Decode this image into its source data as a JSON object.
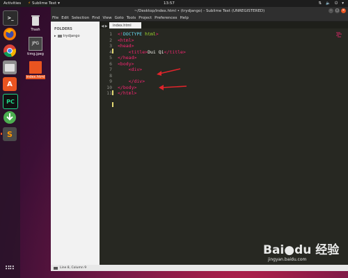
{
  "topbar": {
    "activities": "Activities",
    "app_name": "Sublime Text",
    "clock": "13:57"
  },
  "dock": {
    "items": [
      {
        "name": "terminal",
        "label": ">_"
      },
      {
        "name": "firefox",
        "label": ""
      },
      {
        "name": "chrome",
        "label": ""
      },
      {
        "name": "files",
        "label": ""
      },
      {
        "name": "software",
        "label": "A"
      },
      {
        "name": "pycharm",
        "label": "PC"
      },
      {
        "name": "update",
        "label": ""
      },
      {
        "name": "sublime",
        "label": "S"
      }
    ]
  },
  "desktop": {
    "trash_label": "Trash",
    "jpeg_label": "timg.jpeg",
    "jpeg_badge": "JPG",
    "html_label": "index.html"
  },
  "window": {
    "title": "~/Desktop/index.html • (trydjango) - Sublime Text (UNREGISTERED)",
    "menu": [
      "File",
      "Edit",
      "Selection",
      "Find",
      "View",
      "Goto",
      "Tools",
      "Project",
      "Preferences",
      "Help"
    ],
    "sidebar": {
      "header": "FOLDERS",
      "folder": "trydjango"
    },
    "tab": "index.html",
    "line_numbers": [
      "1",
      "2",
      "3",
      "4",
      "5",
      "6",
      "7",
      "8",
      "9",
      "10",
      "11"
    ],
    "statusbar": "Line 8, Column 9"
  },
  "colors": {
    "accent": "#e95420",
    "arrow": "#e0242b",
    "editor_bg": "#272822"
  },
  "watermark": {
    "logo": "Bai●du 经验",
    "url": "jingyan.baidu.com"
  }
}
